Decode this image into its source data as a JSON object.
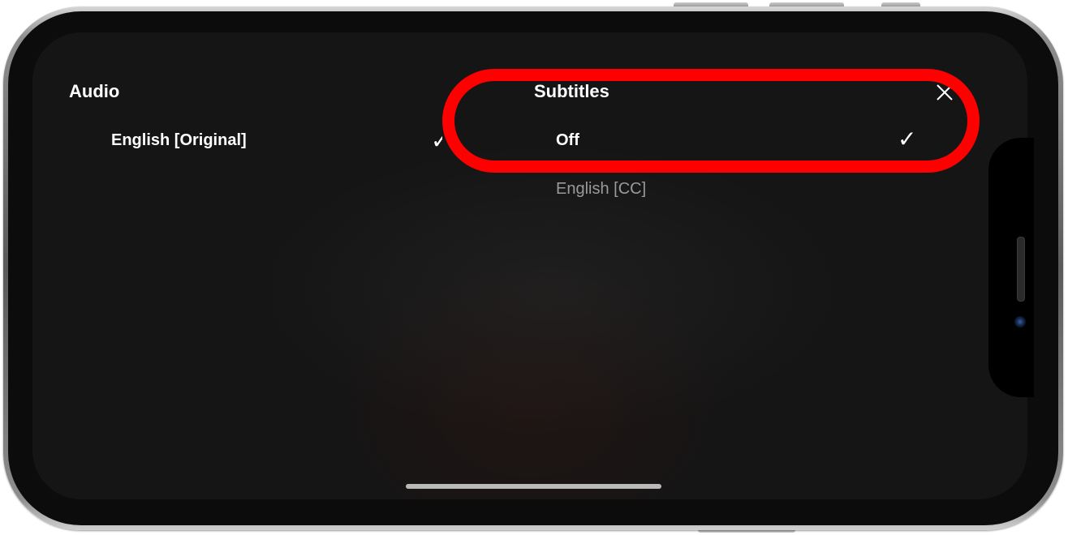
{
  "audio": {
    "heading": "Audio",
    "options": [
      {
        "label": "English [Original]",
        "selected": true
      }
    ]
  },
  "subtitles": {
    "heading": "Subtitles",
    "options": [
      {
        "label": "Off",
        "selected": true
      },
      {
        "label": "English [CC]",
        "selected": false
      }
    ]
  },
  "icons": {
    "close": "close-icon",
    "check": "checkmark-icon"
  },
  "colors": {
    "highlight": "#ff0000",
    "background": "#151515",
    "text_primary": "#ffffff",
    "text_muted": "#9a9a9a"
  }
}
